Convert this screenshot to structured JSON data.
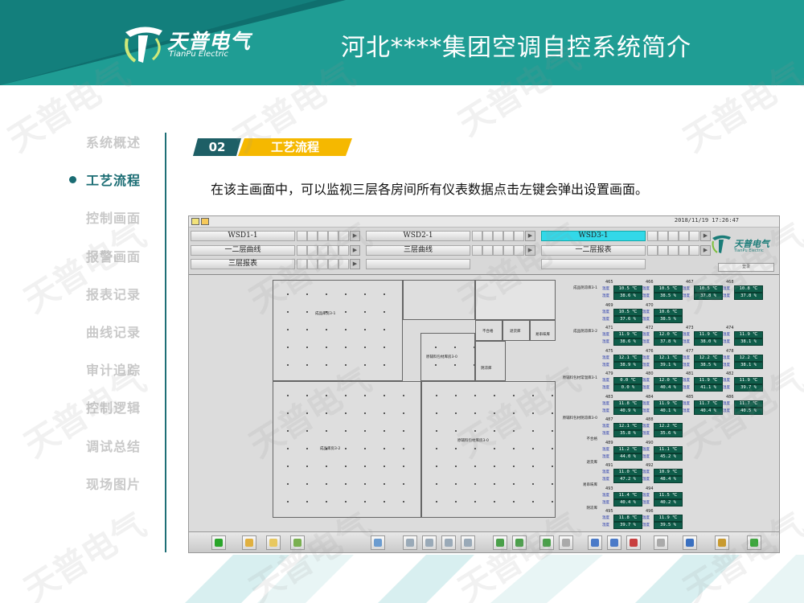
{
  "header": {
    "logo_cn": "天普电气",
    "logo_en": "TianPu Electric",
    "title": "河北****集团空调自控系统简介"
  },
  "colors": {
    "teal": "#1f9d94",
    "dark_teal": "#1e5f66",
    "yellow": "#f5b800",
    "inactive_nav": "#c9c9c9"
  },
  "sidebar": {
    "items": [
      {
        "label": "系统概述",
        "active": false
      },
      {
        "label": "工艺流程",
        "active": true
      },
      {
        "label": "控制画面",
        "active": false
      },
      {
        "label": "报警画面",
        "active": false
      },
      {
        "label": "报表记录",
        "active": false
      },
      {
        "label": "曲线记录",
        "active": false
      },
      {
        "label": "审计追踪",
        "active": false
      },
      {
        "label": "控制逻辑",
        "active": false
      },
      {
        "label": "调试总结",
        "active": false
      },
      {
        "label": "现场图片",
        "active": false
      }
    ]
  },
  "section": {
    "number": "02",
    "title": "工艺流程"
  },
  "intro": "在该主画面中，可以监视三层各房间所有仪表数据点击左键会弹出设置画面。",
  "scada": {
    "timestamp": "2018/11/19 17:26:47",
    "nav_buttons": [
      {
        "label": "WSD1-1",
        "selected": false
      },
      {
        "label": "WSD2-1",
        "selected": false
      },
      {
        "label": "WSD3-1",
        "selected": true
      },
      {
        "label": "一二层曲线",
        "selected": false
      },
      {
        "label": "三层曲线",
        "selected": false
      },
      {
        "label": "一二层报表",
        "selected": false
      },
      {
        "label": "三层报表",
        "selected": false
      }
    ],
    "logo_cn": "天普电气",
    "logo_en": "TianPu Electric",
    "login": "登录",
    "rooms": {
      "r1": "成品库房3-1",
      "r2": "原辅料包材库房3-0",
      "r3": "不合格",
      "r4": "退货库",
      "r5": "易串味库",
      "r6": "阴凉库",
      "r7": "成品库房3-2",
      "r8": "原辅料包材库房3-0"
    },
    "sensor_groups": [
      {
        "name": "成品阴凉库3-1"
      },
      {
        "name": "成品阴凉库3-2"
      },
      {
        "name": "原辅料包材常温库3-1"
      },
      {
        "name": "原辅料包材阴凉库3-0"
      },
      {
        "name": "不合格"
      },
      {
        "name": "退货库"
      },
      {
        "name": "易串味库"
      },
      {
        "name": "阴凉库"
      }
    ],
    "temp_label": "温度",
    "humid_label": "湿度",
    "sensors": [
      {
        "id": "465",
        "t": "10.5 ℃",
        "h": "38.6 %"
      },
      {
        "id": "466",
        "t": "10.5 ℃",
        "h": "38.5 %"
      },
      {
        "id": "467",
        "t": "10.5 ℃",
        "h": "37.8 %"
      },
      {
        "id": "468",
        "t": "10.8 ℃",
        "h": "37.8 %"
      },
      {
        "id": "469",
        "t": "10.5 ℃",
        "h": "37.6 %"
      },
      {
        "id": "470",
        "t": "10.6 ℃",
        "h": "38.5 %"
      },
      {
        "id": "471",
        "t": "11.9 ℃",
        "h": "38.6 %"
      },
      {
        "id": "472",
        "t": "12.0 ℃",
        "h": "37.8 %"
      },
      {
        "id": "473",
        "t": "11.9 ℃",
        "h": "38.0 %"
      },
      {
        "id": "474",
        "t": "11.9 ℃",
        "h": "38.1 %"
      },
      {
        "id": "475",
        "t": "12.1 ℃",
        "h": "38.9 %"
      },
      {
        "id": "476",
        "t": "12.1 ℃",
        "h": "39.1 %"
      },
      {
        "id": "477",
        "t": "12.2 ℃",
        "h": "38.5 %"
      },
      {
        "id": "478",
        "t": "12.2 ℃",
        "h": "38.1 %"
      },
      {
        "id": "479",
        "t": "0.0 ℃",
        "h": "0.0 %"
      },
      {
        "id": "480",
        "t": "12.0 ℃",
        "h": "40.4 %"
      },
      {
        "id": "481",
        "t": "11.9 ℃",
        "h": "41.1 %"
      },
      {
        "id": "482",
        "t": "11.9 ℃",
        "h": "39.7 %"
      },
      {
        "id": "483",
        "t": "11.8 ℃",
        "h": "40.9 %"
      },
      {
        "id": "484",
        "t": "11.9 ℃",
        "h": "40.1 %"
      },
      {
        "id": "485",
        "t": "11.7 ℃",
        "h": "40.4 %"
      },
      {
        "id": "486",
        "t": "11.7 ℃",
        "h": "40.5 %"
      },
      {
        "id": "487",
        "t": "12.1 ℃",
        "h": "35.8 %"
      },
      {
        "id": "488",
        "t": "12.2 ℃",
        "h": "35.6 %"
      },
      {
        "id": "489",
        "t": "11.2 ℃",
        "h": "44.0 %"
      },
      {
        "id": "490",
        "t": "11.1 ℃",
        "h": "45.2 %"
      },
      {
        "id": "491",
        "t": "11.0 ℃",
        "h": "47.2 %"
      },
      {
        "id": "492",
        "t": "10.9 ℃",
        "h": "48.4 %"
      },
      {
        "id": "493",
        "t": "11.4 ℃",
        "h": "40.4 %"
      },
      {
        "id": "494",
        "t": "11.5 ℃",
        "h": "40.2 %"
      },
      {
        "id": "495",
        "t": "11.8 ℃",
        "h": "39.7 %"
      },
      {
        "id": "496",
        "t": "11.9 ℃",
        "h": "39.5 %"
      }
    ]
  },
  "watermark": "天普电气"
}
